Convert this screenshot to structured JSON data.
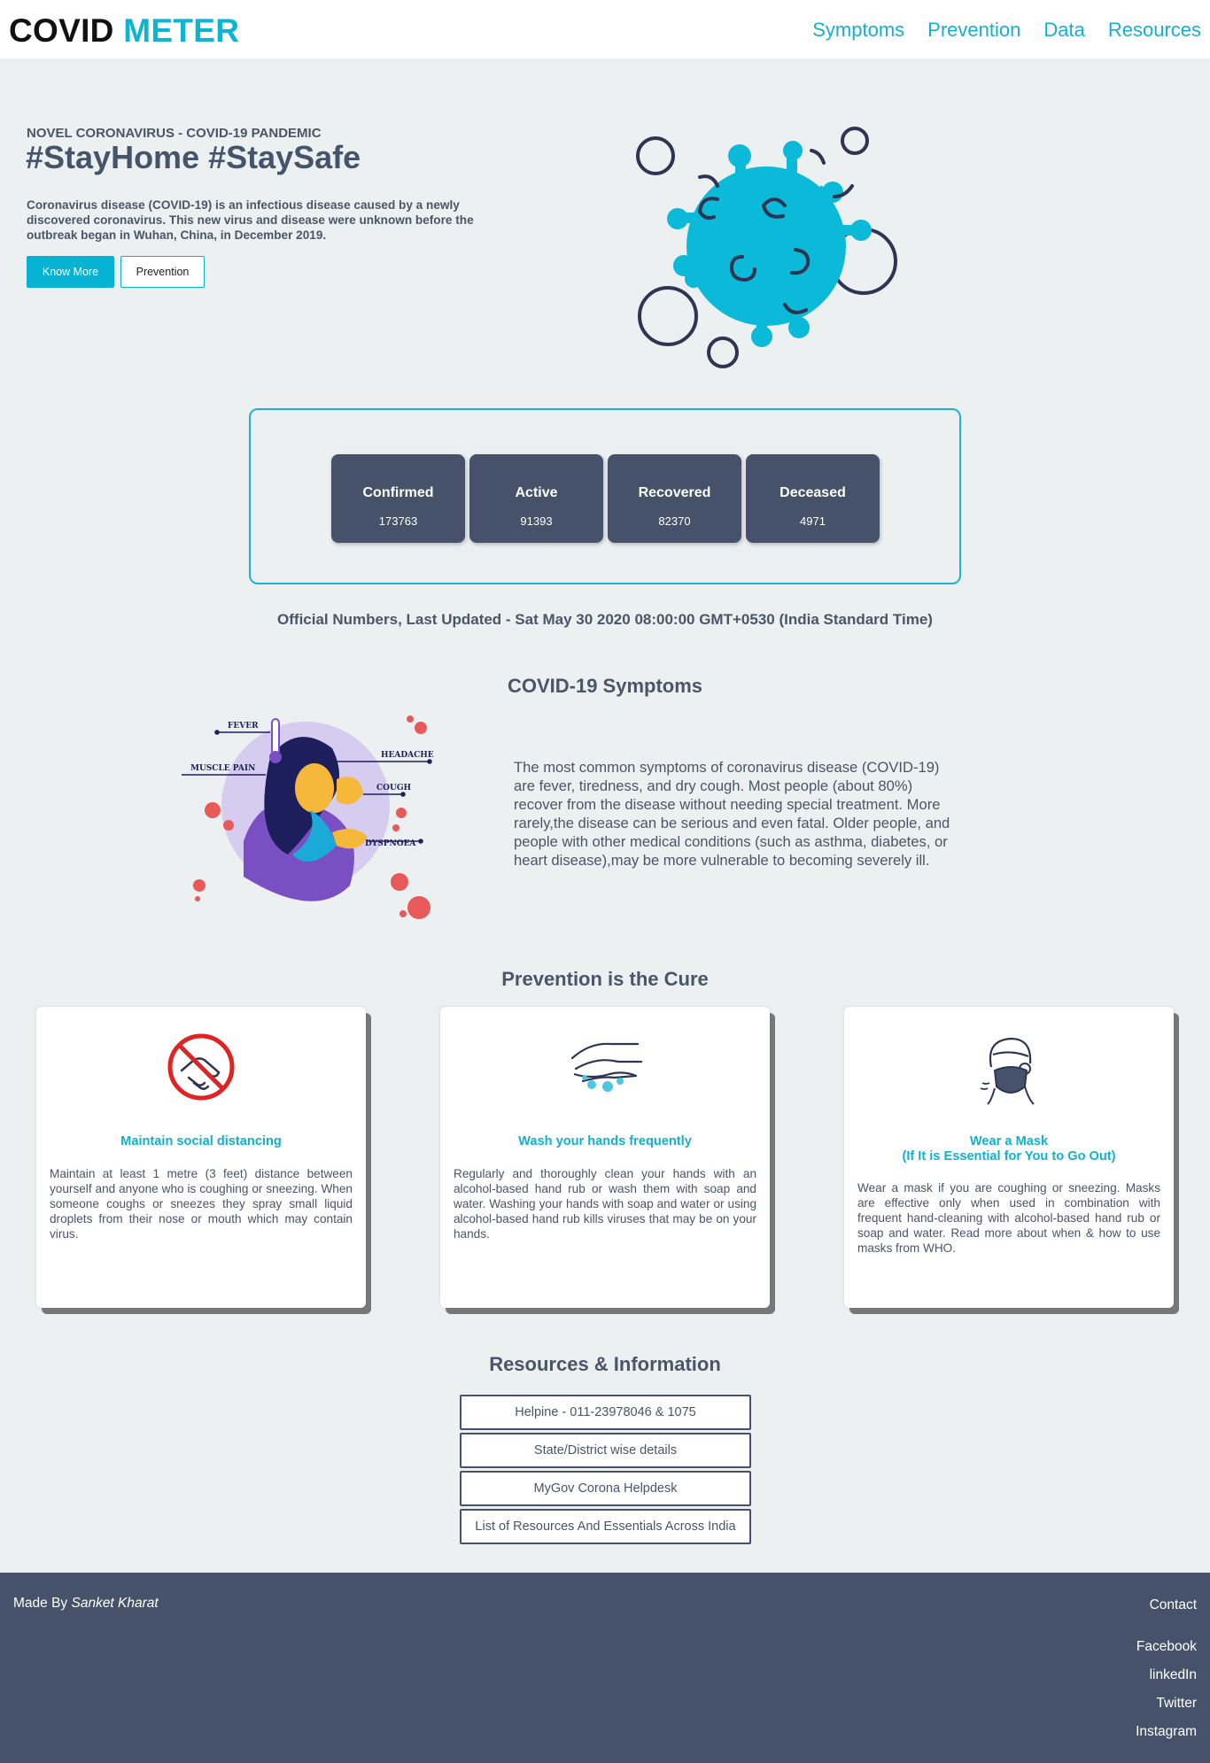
{
  "nav": {
    "logo_part1": "COVID",
    "logo_part2": "METER",
    "links": [
      "Symptoms",
      "Prevention",
      "Data",
      "Resources"
    ]
  },
  "hero": {
    "tagline": "NOVEL CORONAVIRUS - COVID-19 PANDEMIC",
    "title": "#StayHome #StaySafe",
    "text": "Coronavirus disease (COVID-19) is an infectious disease caused by a newly discovered coronavirus. This new virus and disease were unknown before the outbreak began in Wuhan, China, in December 2019.",
    "btn_know_more": "Know More",
    "btn_prevention": "Prevention"
  },
  "stats": [
    {
      "label": "Confirmed",
      "value": "173763"
    },
    {
      "label": "Active",
      "value": "91393"
    },
    {
      "label": "Recovered",
      "value": "82370"
    },
    {
      "label": "Deceased",
      "value": "4971"
    }
  ],
  "updated": "Official Numbers, Last Updated - Sat May 30 2020 08:00:00 GMT+0530 (India Standard Time)",
  "symptoms": {
    "title": "COVID-19 Symptoms",
    "labels": [
      "FEVER",
      "HEADACHE",
      "MUSCLE PAIN",
      "COUGH",
      "DYSPNOEA"
    ],
    "text": "The most common symptoms of coronavirus disease (COVID-19) are fever, tiredness, and dry cough. Most people (about 80%) recover from the disease without needing special treatment. More rarely,the disease can be serious and even fatal. Older people, and people with other medical conditions (such as asthma, diabetes, or heart disease),may be more vulnerable to becoming severely ill."
  },
  "prevention": {
    "title": "Prevention is the Cure",
    "cards": [
      {
        "title": "Maintain social distancing",
        "subtitle": "",
        "text": "Maintain at least 1 metre (3 feet) distance between yourself and anyone who is coughing or sneezing. When someone coughs or sneezes they spray small liquid droplets from their nose or mouth which may contain virus.",
        "icon": "no-handshake-icon"
      },
      {
        "title": "Wash your hands frequently",
        "subtitle": "",
        "text": "Regularly and thoroughly clean your hands with an alcohol-based hand rub or wash them with soap and water. Washing your hands with soap and water or using alcohol-based hand rub kills viruses that may be on your hands.",
        "icon": "hand-wash-icon"
      },
      {
        "title": "Wear a Mask",
        "subtitle": "(If It is Essential for You to Go Out)",
        "text": "Wear a mask if you are coughing or sneezing. Masks are effective only when used in combination with frequent hand-cleaning with alcohol-based hand rub or soap and water. Read more about when & how to use masks from WHO.",
        "icon": "face-mask-icon"
      }
    ]
  },
  "resources": {
    "title": "Resources & Information",
    "links": [
      "Helpine - 011-23978046 & 1075",
      "State/District wise details",
      "MyGov Corona Helpdesk",
      "List of Resources And Essentials Across India"
    ]
  },
  "footer": {
    "made_by_prefix": "Made By",
    "author": "Sanket Kharat",
    "contact": "Contact",
    "links": [
      "Facebook",
      "linkedIn",
      "Twitter",
      "Instagram"
    ]
  },
  "colors": {
    "accent": "#06b3d2",
    "dark": "#46526a",
    "background": "#edf0f1"
  }
}
